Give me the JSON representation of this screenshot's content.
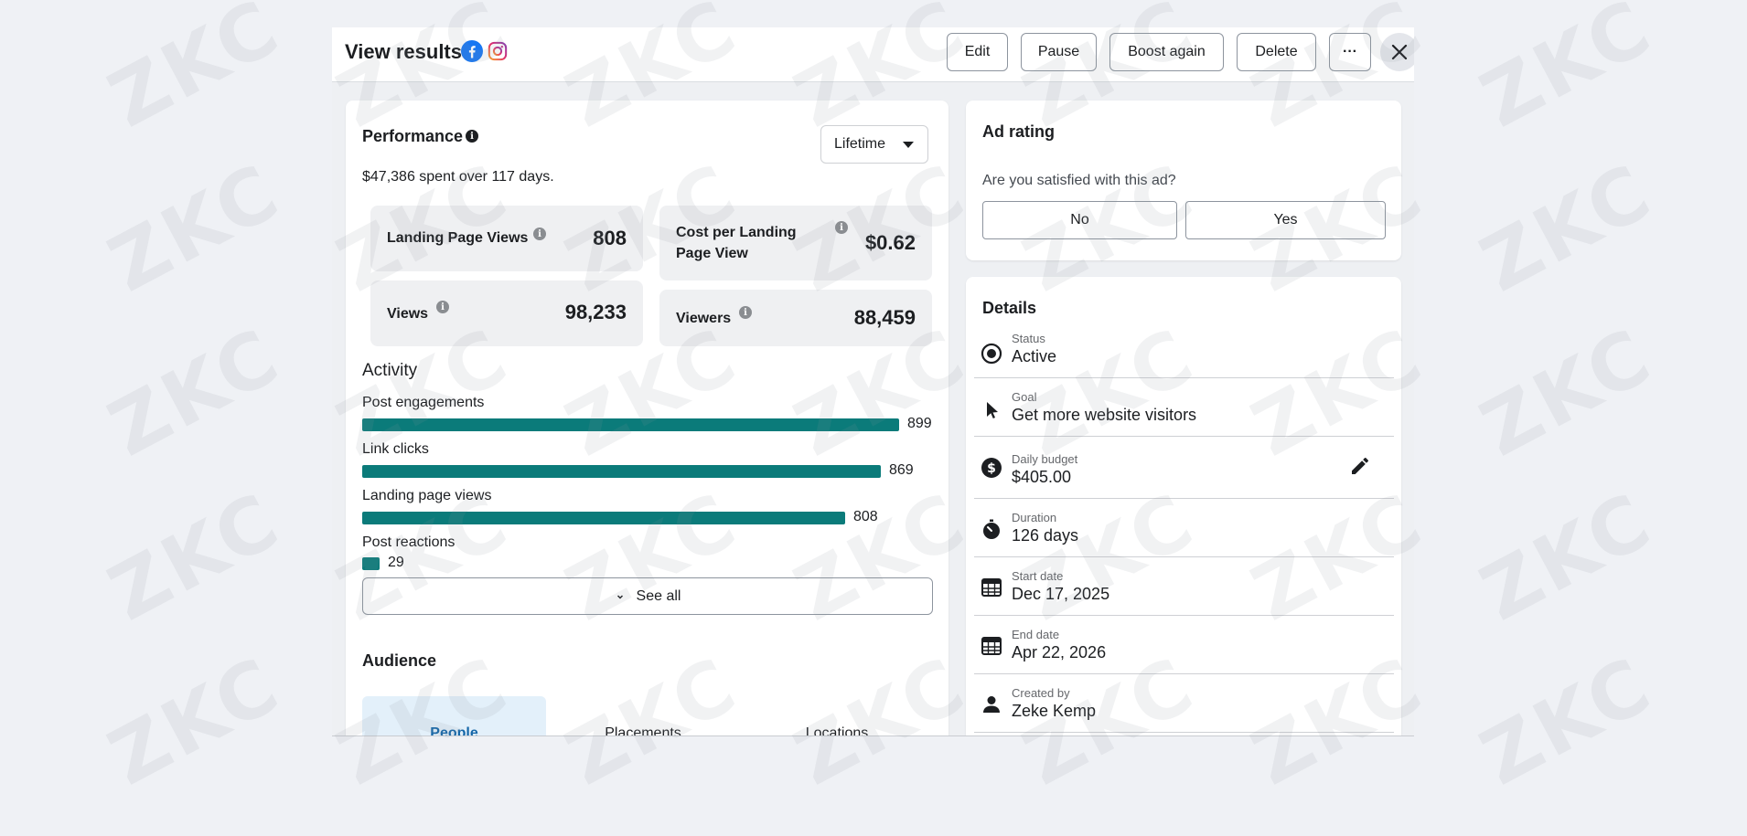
{
  "header": {
    "title": "View results",
    "buttons": {
      "edit": "Edit",
      "pause": "Pause",
      "boost": "Boost again",
      "delete": "Delete",
      "more": "···"
    },
    "icons": [
      "facebook-icon",
      "instagram-icon",
      "close-icon"
    ]
  },
  "performance": {
    "title": "Performance",
    "period": "Lifetime",
    "summary": "$47,386 spent over 117 days.",
    "metrics": [
      {
        "label": "Landing Page Views",
        "value": "808"
      },
      {
        "label": "Cost per Landing Page View",
        "value": "$0.62"
      },
      {
        "label": "Views",
        "value": "98,233"
      },
      {
        "label": "Viewers",
        "value": "88,459"
      }
    ]
  },
  "activity": {
    "title": "Activity",
    "max": 899,
    "items": [
      {
        "label": "Post engagements",
        "value": 899
      },
      {
        "label": "Link clicks",
        "value": 869
      },
      {
        "label": "Landing page views",
        "value": 808
      },
      {
        "label": "Post reactions",
        "value": 29
      }
    ],
    "see_all": "See all"
  },
  "audience": {
    "title": "Audience",
    "tabs": [
      "People",
      "Placements",
      "Locations"
    ],
    "active_tab": "People"
  },
  "ad_rating": {
    "title": "Ad rating",
    "question": "Are you satisfied with this ad?",
    "no": "No",
    "yes": "Yes"
  },
  "details": {
    "title": "Details",
    "rows": [
      {
        "label": "Status",
        "value": "Active",
        "icon": "status-radio-icon"
      },
      {
        "label": "Goal",
        "value": "Get more website visitors",
        "icon": "cursor-icon"
      },
      {
        "label": "Daily budget",
        "value": "$405.00",
        "icon": "dollar-icon"
      },
      {
        "label": "Duration",
        "value": "126 days",
        "icon": "stopwatch-icon"
      },
      {
        "label": "Start date",
        "value": "Dec 17, 2025",
        "icon": "calendar-icon"
      },
      {
        "label": "End date",
        "value": "Apr 22, 2026",
        "icon": "calendar-icon"
      },
      {
        "label": "Created by",
        "value": "Zeke Kemp",
        "icon": "person-icon"
      }
    ]
  },
  "watermark": "ZKC",
  "colors": {
    "bar": "#0b7b7a",
    "active_tab_bg": "#e3f0fa",
    "active_tab_text": "#1466a8",
    "facebook": "#1877f2"
  }
}
